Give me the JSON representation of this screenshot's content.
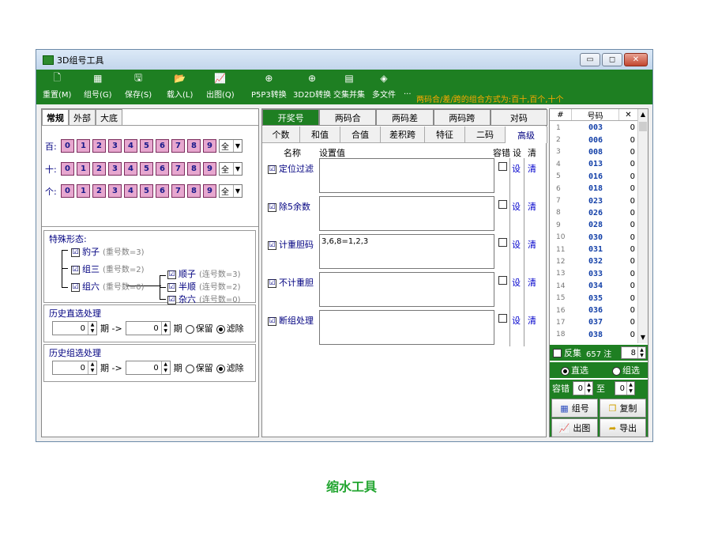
{
  "window": {
    "title": "3D组号工具",
    "minimize": "▭",
    "maximize": "◻",
    "close": "✕"
  },
  "toolbar": {
    "items": [
      {
        "label": "重置(M)",
        "icon": "new-doc-icon",
        "glyph": "🗋"
      },
      {
        "label": "组号(G)",
        "icon": "grid-icon",
        "glyph": "▦"
      },
      {
        "label": "保存(S)",
        "icon": "save-icon",
        "glyph": "🖫"
      },
      {
        "label": "载入(L)",
        "icon": "folder-icon",
        "glyph": "📂"
      },
      {
        "label": "出图(Q)",
        "icon": "chart-icon",
        "glyph": "📈"
      },
      {
        "label": "P5P3转换",
        "icon": "target-icon",
        "glyph": "⊕"
      },
      {
        "label": "3D2D转换",
        "icon": "target-icon",
        "glyph": "⊕"
      },
      {
        "label": "交集并集",
        "icon": "books-icon",
        "glyph": "▤"
      },
      {
        "label": "多文件",
        "icon": "cube-icon",
        "glyph": "◈"
      }
    ],
    "more": "...",
    "hint": "两码合/差/跨的组合方式为:百十,百个,十个"
  },
  "left": {
    "tabs": [
      "常规",
      "外部",
      "大底"
    ],
    "digit_rows": [
      {
        "label": "百:",
        "select": "全"
      },
      {
        "label": "十:",
        "select": "全"
      },
      {
        "label": "个:",
        "select": "全"
      }
    ],
    "digits": [
      "0",
      "1",
      "2",
      "3",
      "4",
      "5",
      "6",
      "7",
      "8",
      "9"
    ],
    "special": {
      "title": "特殊形态:",
      "items": [
        {
          "label": "豹子",
          "sub": "(重号数=3)"
        },
        {
          "label": "组三",
          "sub": "(重号数=2)"
        },
        {
          "label": "组六",
          "sub": "(重号数=0)"
        },
        {
          "label": "顺子",
          "sub": "(连号数=3)"
        },
        {
          "label": "半顺",
          "sub": "(连号数=2)"
        },
        {
          "label": "杂六",
          "sub": "(连号数=0)"
        }
      ],
      "check": "☑"
    },
    "hist_direct": {
      "title": "历史直选处理",
      "from": "0",
      "arrow": "期 ->",
      "to": "0",
      "unit": "期",
      "keep": "保留",
      "filter": "滤除"
    },
    "hist_group": {
      "title": "历史组选处理",
      "from": "0",
      "arrow": "期 ->",
      "to": "0",
      "unit": "期",
      "keep": "保留",
      "filter": "滤除"
    }
  },
  "middle": {
    "tabs_top": [
      "开奖号",
      "两码合",
      "两码差",
      "两码跨",
      "对码"
    ],
    "tabs_second": [
      "个数",
      "和值",
      "合值",
      "差积跨",
      "特征",
      "二码",
      "高级"
    ],
    "headers": {
      "name": "名称",
      "value": "设置值",
      "tolerance": "容错",
      "set": "设",
      "clear": "清"
    },
    "rows": [
      {
        "name": "定位过滤",
        "value": "",
        "set": "设",
        "clear": "清"
      },
      {
        "name": "除5余数",
        "value": "",
        "set": "设",
        "clear": "清"
      },
      {
        "name": "计重胆码",
        "value": "3,6,8=1,2,3",
        "set": "设",
        "clear": "清"
      },
      {
        "name": "不计重胆",
        "value": "",
        "set": "设",
        "clear": "清"
      },
      {
        "name": "断组处理",
        "value": "",
        "set": "设",
        "clear": "清"
      }
    ]
  },
  "right": {
    "headers": {
      "num": "#",
      "code": "号码",
      "x": "✕"
    },
    "rows": [
      {
        "n": "1",
        "code": "003",
        "x": "0"
      },
      {
        "n": "2",
        "code": "006",
        "x": "0"
      },
      {
        "n": "3",
        "code": "008",
        "x": "0"
      },
      {
        "n": "4",
        "code": "013",
        "x": "0"
      },
      {
        "n": "5",
        "code": "016",
        "x": "0"
      },
      {
        "n": "6",
        "code": "018",
        "x": "0"
      },
      {
        "n": "7",
        "code": "023",
        "x": "0"
      },
      {
        "n": "8",
        "code": "026",
        "x": "0"
      },
      {
        "n": "9",
        "code": "028",
        "x": "0"
      },
      {
        "n": "10",
        "code": "030",
        "x": "0"
      },
      {
        "n": "11",
        "code": "031",
        "x": "0"
      },
      {
        "n": "12",
        "code": "032",
        "x": "0"
      },
      {
        "n": "13",
        "code": "033",
        "x": "0"
      },
      {
        "n": "14",
        "code": "034",
        "x": "0"
      },
      {
        "n": "15",
        "code": "035",
        "x": "0"
      },
      {
        "n": "16",
        "code": "036",
        "x": "0"
      },
      {
        "n": "17",
        "code": "037",
        "x": "0"
      },
      {
        "n": "18",
        "code": "038",
        "x": "0"
      }
    ],
    "reverse_label": "反集",
    "count": "657 注",
    "per_row": "8",
    "direct": "直选",
    "group": "组选",
    "tolerance_label": "容错",
    "tol_from": "0",
    "tol_to_label": "至",
    "tol_to": "0",
    "btn_group": "组号",
    "btn_copy": "复制",
    "btn_chart": "出图",
    "btn_export": "导出"
  },
  "caption": "缩水工具"
}
